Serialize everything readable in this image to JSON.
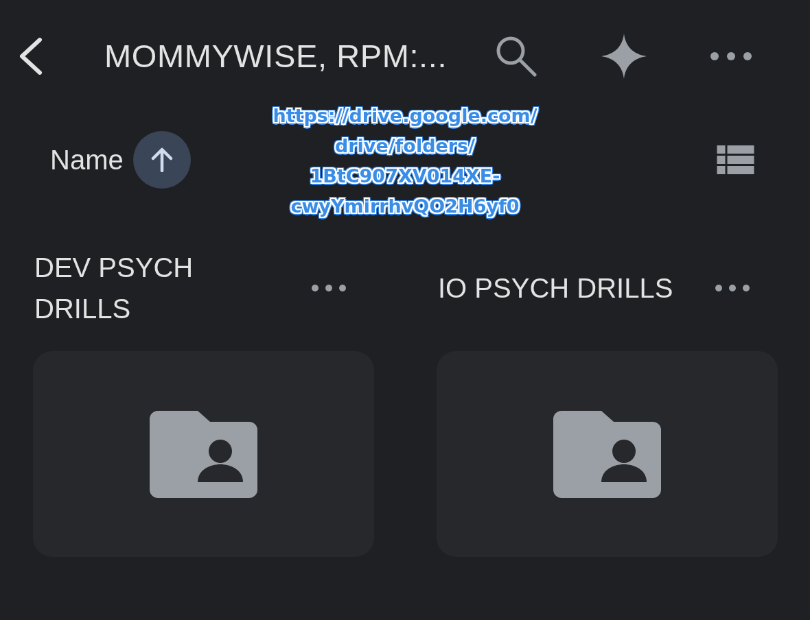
{
  "toolbar": {
    "title": "MOMMYWISE, RPM:..."
  },
  "sort": {
    "label": "Name",
    "ascending": true
  },
  "url_annotation": {
    "lines": [
      "https://drive.google.com/",
      "drive/folders/",
      "1BtC907XV014XE-",
      "cwyYmirrhvQO2H6yf0"
    ]
  },
  "folders": [
    {
      "name": "DEV PSYCH DRILLS",
      "kind": "shared"
    },
    {
      "name": "IO PSYCH DRILLS",
      "kind": "shared"
    }
  ]
}
